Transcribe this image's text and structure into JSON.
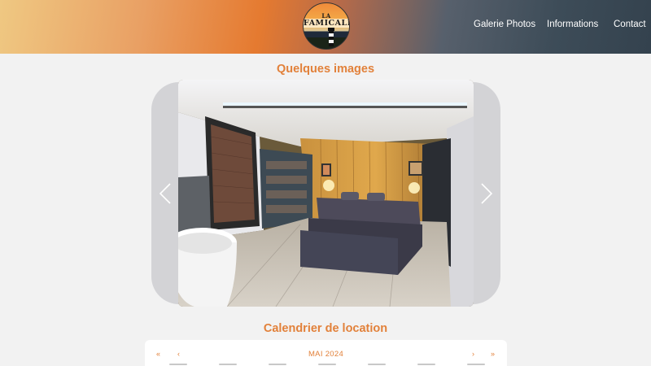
{
  "header": {
    "logo": {
      "line1": "LA",
      "line2": "FAMICALE",
      "icon": "lighthouse-logo"
    },
    "nav": [
      {
        "label": "Galerie Photos"
      },
      {
        "label": "Informations"
      },
      {
        "label": "Contact"
      }
    ]
  },
  "gallery": {
    "title": "Quelques images",
    "prev_icon": "chevron-left-icon",
    "next_icon": "chevron-right-icon",
    "photo_alt": "bedroom-photo"
  },
  "calendar": {
    "title": "Calendrier de location",
    "month": "MAI 2024",
    "prev_year": "«",
    "prev_month": "‹",
    "next_month": "›",
    "next_year": "»"
  },
  "colors": {
    "accent": "#e2813a",
    "page_bg": "#f2f2f2",
    "carousel_bg": "#d3d3d6"
  }
}
